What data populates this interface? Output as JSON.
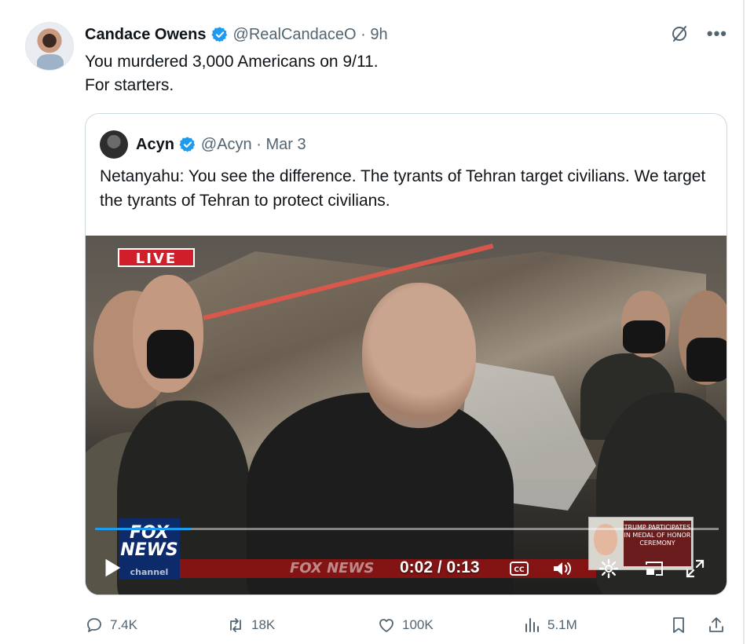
{
  "tweet": {
    "author_name": "Candace Owens",
    "handle_time": "@RealCandaceO · 9h",
    "text_line1": "You murdered 3,000 Americans on 9/11.",
    "text_line2": "For starters."
  },
  "quoted": {
    "author_name": "Acyn",
    "handle_time": "@Acyn · Mar 3",
    "text": "Netanyahu: You see the difference. The tyrants of Tehran target civilians. We target the tyrants of Tehran to protect civilians."
  },
  "video": {
    "live_label": "LIVE",
    "channel_bug_line1": "FOX",
    "channel_bug_line2": "NEWS",
    "channel_bug_sub": "channel",
    "ticker_logo": "FOX NEWS",
    "inset_caption": "TRUMP PARTICIPATES IN MEDAL OF HONOR CEREMONY",
    "current_time": "0:02",
    "duration": "0:13",
    "time_display": "0:02 / 0:13",
    "progress_fraction": 0.154
  },
  "actions": {
    "replies": "7.4K",
    "retweets": "18K",
    "likes": "100K",
    "views": "5.1M"
  },
  "colors": {
    "accent": "#1d9bf0",
    "text_primary": "#0f1419",
    "text_secondary": "#536471",
    "border": "#cfd9de",
    "live_red": "#d11e2b"
  },
  "icons": {
    "verified": "verified-badge-icon",
    "grok": "grok-icon",
    "more": "more-icon",
    "reply": "reply-icon",
    "retweet": "retweet-icon",
    "like": "heart-icon",
    "views": "views-icon",
    "bookmark": "bookmark-icon",
    "share": "share-icon",
    "play": "play-icon",
    "captions": "captions-icon",
    "volume": "volume-icon",
    "settings": "gear-icon",
    "pip": "pip-icon",
    "fullscreen": "fullscreen-icon"
  }
}
